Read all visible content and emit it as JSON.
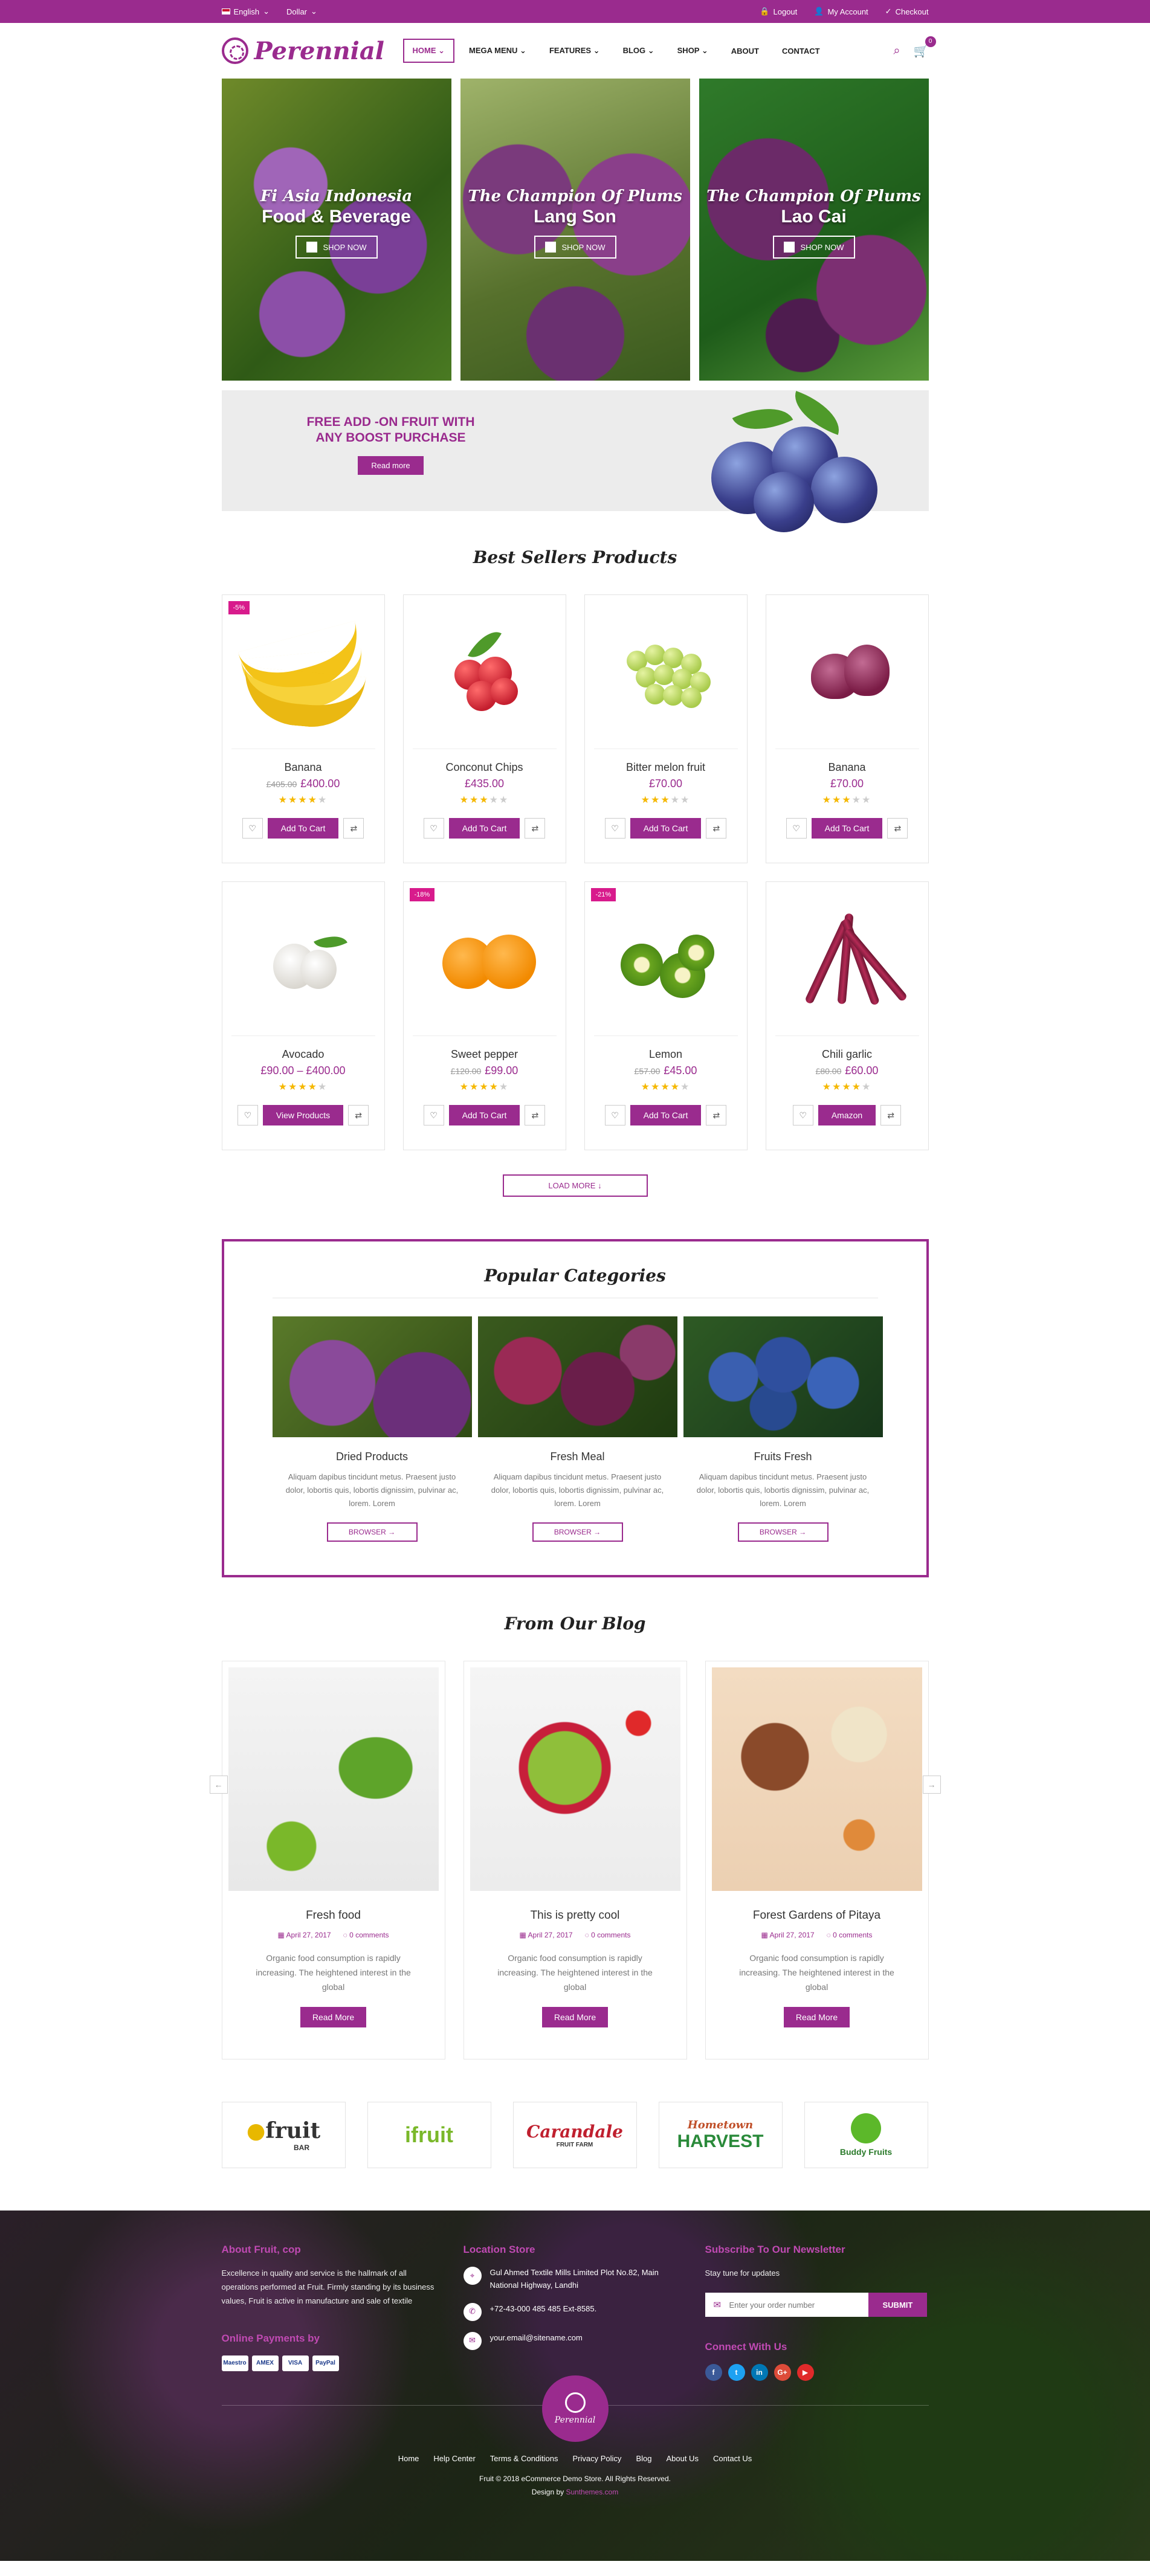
{
  "topbar": {
    "language": "English",
    "currency": "Dollar",
    "logout": "Logout",
    "account": "My Account",
    "checkout": "Checkout"
  },
  "header": {
    "logo": "Perennial",
    "nav": [
      "HOME",
      "MEGA MENU",
      "FEATURES",
      "BLOG",
      "SHOP",
      "ABOUT",
      "CONTACT"
    ],
    "cart_count": "0"
  },
  "hero": [
    {
      "sub": "Fi Asia Indonesia",
      "title": "Food & Beverage",
      "button": "SHOP NOW"
    },
    {
      "sub": "The Champion Of Plums",
      "title": "Lang Son",
      "button": "SHOP NOW"
    },
    {
      "sub": "The Champion Of Plums",
      "title": "Lao Cai",
      "button": "SHOP NOW"
    }
  ],
  "promo": {
    "title_line1": "FREE ADD -ON FRUIT WITH",
    "title_line2": "ANY BOOST PURCHASE",
    "button": "Read more"
  },
  "best_sellers": {
    "title": "Best Sellers Products",
    "products": [
      {
        "name": "Banana",
        "old_price": "£405.00",
        "price": "£400.00",
        "badge": "-5%",
        "rating": 4,
        "button": "Add To Cart"
      },
      {
        "name": "Conconut Chips",
        "old_price": "",
        "price": "£435.00",
        "badge": "",
        "rating": 3,
        "button": "Add To Cart"
      },
      {
        "name": "Bitter melon fruit",
        "old_price": "",
        "price": "£70.00",
        "badge": "",
        "rating": 3,
        "button": "Add To Cart"
      },
      {
        "name": "Banana",
        "old_price": "",
        "price": "£70.00",
        "badge": "",
        "rating": 3,
        "button": "Add To Cart"
      },
      {
        "name": "Avocado",
        "old_price": "",
        "price": "£90.00 – £400.00",
        "badge": "",
        "rating": 4,
        "button": "View Products"
      },
      {
        "name": "Sweet pepper",
        "old_price": "£120.00",
        "price": "£99.00",
        "badge": "-18%",
        "rating": 4,
        "button": "Add To Cart"
      },
      {
        "name": "Lemon",
        "old_price": "£57.00",
        "price": "£45.00",
        "badge": "-21%",
        "rating": 4,
        "button": "Add To Cart"
      },
      {
        "name": "Chili garlic",
        "old_price": "£80.00",
        "price": "£60.00",
        "badge": "",
        "rating": 4,
        "button": "Amazon"
      }
    ],
    "load_more": "LOAD MORE"
  },
  "categories": {
    "title": "Popular Categories",
    "items": [
      {
        "name": "Dried Products",
        "desc": "Aliquam dapibus tincidunt metus. Praesent justo dolor, lobortis quis, lobortis dignissim, pulvinar ac, lorem. Lorem",
        "button": "BROWSER"
      },
      {
        "name": "Fresh Meal",
        "desc": "Aliquam dapibus tincidunt metus. Praesent justo dolor, lobortis quis, lobortis dignissim, pulvinar ac, lorem. Lorem",
        "button": "BROWSER"
      },
      {
        "name": "Fruits Fresh",
        "desc": "Aliquam dapibus tincidunt metus. Praesent justo dolor, lobortis quis, lobortis dignissim, pulvinar ac, lorem. Lorem",
        "button": "BROWSER"
      }
    ]
  },
  "blog": {
    "title": "From Our Blog",
    "posts": [
      {
        "title": "Fresh food",
        "date": "April 27, 2017",
        "comments": "0 comments",
        "desc": "Organic food consumption is rapidly increasing. The heightened interest in the global",
        "button": "Read More"
      },
      {
        "title": "This is pretty cool",
        "date": "April 27, 2017",
        "comments": "0 comments",
        "desc": "Organic food consumption is rapidly increasing. The heightened interest in the global",
        "button": "Read More"
      },
      {
        "title": "Forest Gardens of Pitaya",
        "date": "April 27, 2017",
        "comments": "0 comments",
        "desc": "Organic food consumption is rapidly increasing. The heightened interest in the global",
        "button": "Read More"
      }
    ]
  },
  "brands": [
    {
      "name": "fruit",
      "sub": "BAR"
    },
    {
      "name": "ifruit",
      "sub": ""
    },
    {
      "name": "Carandale",
      "sub": "FRUIT FARM"
    },
    {
      "name": "Hometown",
      "sub": "HARVEST"
    },
    {
      "name": "Buddy Fruits",
      "sub": ""
    }
  ],
  "footer": {
    "about_title": "About Fruit, cop",
    "about_text": "Excellence in quality and service is the hallmark of all operations performed at Fruit. Firmly standing by its business values, Fruit is active in manufacture and sale of textile",
    "payments_title": "Online Payments by",
    "payments": [
      "Maestro",
      "AMEX",
      "VISA",
      "PayPal"
    ],
    "location_title": "Location Store",
    "address": "Gul Ahmed Textile Mills Limited Plot No.82, Main National Highway, Landhi",
    "phone": "+72-43-000 485 485 Ext-8585.",
    "email": "your.email@sitename.com",
    "newsletter_title": "Subscribe To Our Newsletter",
    "newsletter_sub": "Stay tune for updates",
    "newsletter_placeholder": "Enter your order number",
    "submit": "SUBMIT",
    "connect_title": "Connect With Us",
    "logo": "Perennial",
    "links": [
      "Home",
      "Help Center",
      "Terms & Conditions",
      "Privacy Policy",
      "Blog",
      "About Us",
      "Contact Us"
    ],
    "copyright": "Fruit © 2018 eCommerce Demo Store. All Rights Reserved.",
    "design_by": "Design by",
    "design_by_name": "Sunthemes.com"
  },
  "colors": {
    "brand": "#9a2b8e",
    "badge": "#d81b8c",
    "star": "#f5b800"
  }
}
